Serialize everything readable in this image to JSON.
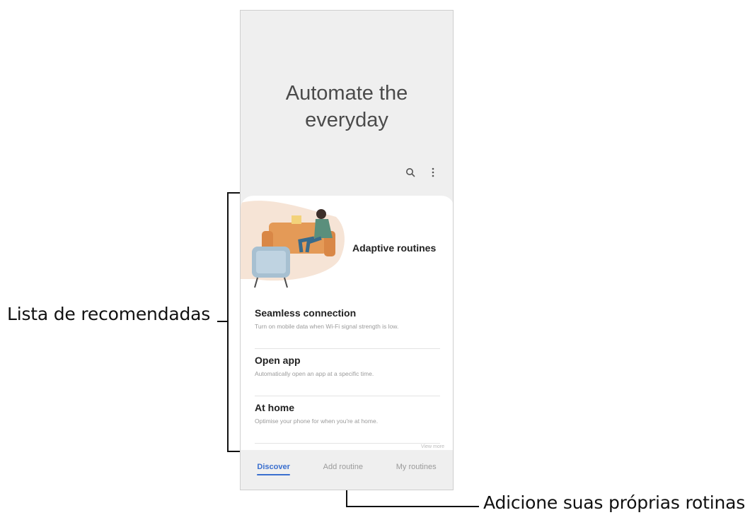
{
  "screen": {
    "headline_line1": "Automate the",
    "headline_line2": "everyday",
    "search_icon": "search-icon",
    "more_icon": "more-vert-icon"
  },
  "card": {
    "hero_title": "Adaptive routines",
    "items": [
      {
        "title": "Seamless connection",
        "subtitle": "Turn on mobile data when Wi-Fi signal strength is low."
      },
      {
        "title": "Open app",
        "subtitle": "Automatically open an app at a specific time."
      },
      {
        "title": "At home",
        "subtitle": "Optimise your phone for when you're at home."
      }
    ],
    "more_hint": "View more"
  },
  "tabs": {
    "discover": "Discover",
    "add_routine": "Add routine",
    "my_routines": "My routines"
  },
  "annotations": {
    "left": "Lista de recomendadas",
    "bottom": "Adicione suas próprias rotinas"
  },
  "colors": {
    "accent": "#3a6fcf",
    "screen_bg": "#efefef"
  }
}
